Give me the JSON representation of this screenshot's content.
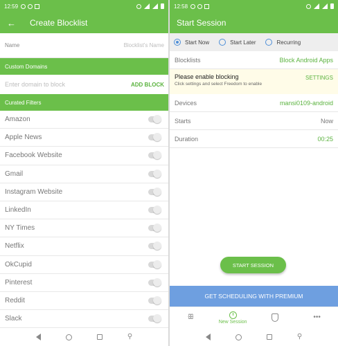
{
  "left": {
    "status": {
      "time": "12:59"
    },
    "appbar": {
      "title": "Create Blocklist",
      "back_icon": "←"
    },
    "name_field": {
      "label": "Name",
      "placeholder": "Blocklist's Name"
    },
    "custom_domains": {
      "header": "Custom Domains",
      "placeholder": "Enter domain to block",
      "add_label": "ADD BLOCK"
    },
    "curated": {
      "header": "Curated Filters",
      "items": [
        "Amazon",
        "Apple News",
        "Facebook Website",
        "Gmail",
        "Instagram Website",
        "LinkedIn",
        "NY Times",
        "Netflix",
        "OkCupid",
        "Pinterest",
        "Reddit",
        "Slack"
      ]
    }
  },
  "right": {
    "status": {
      "time": "12:58"
    },
    "appbar": {
      "title": "Start Session"
    },
    "radios": [
      {
        "label": "Start Now",
        "selected": true
      },
      {
        "label": "Start Later",
        "selected": false
      },
      {
        "label": "Recurring",
        "selected": false
      }
    ],
    "blocklists": {
      "label": "Blocklists",
      "value": "Block Android Apps"
    },
    "warning": {
      "title": "Please enable blocking",
      "subtitle": "Click settings and select Freedom to enable",
      "action": "SETTINGS"
    },
    "devices": {
      "label": "Devices",
      "value": "mansi0109-android"
    },
    "starts": {
      "label": "Starts",
      "value": "Now"
    },
    "duration": {
      "label": "Duration",
      "value": "00:25"
    },
    "start_button": "START SESSION",
    "premium_banner": "GET SCHEDULING WITH PREMIUM",
    "tabs": [
      {
        "icon": "butterfly-icon",
        "label": ""
      },
      {
        "icon": "clock-icon",
        "label": "New Session"
      },
      {
        "icon": "shield-icon",
        "label": ""
      },
      {
        "icon": "more-icon",
        "label": ""
      }
    ]
  },
  "colors": {
    "accent": "#6bbf4a",
    "premium": "#6e9fe0",
    "radio": "#4e8fd8",
    "warning_bg": "#fffce8"
  }
}
